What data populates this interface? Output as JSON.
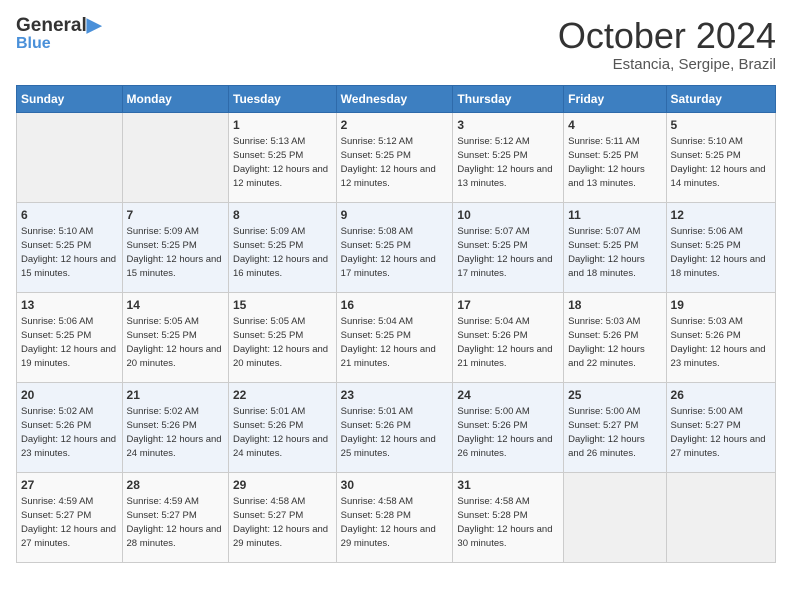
{
  "header": {
    "logo_line1": "General",
    "logo_line2": "Blue",
    "month": "October 2024",
    "location": "Estancia, Sergipe, Brazil"
  },
  "weekdays": [
    "Sunday",
    "Monday",
    "Tuesday",
    "Wednesday",
    "Thursday",
    "Friday",
    "Saturday"
  ],
  "weeks": [
    [
      {
        "day": "",
        "sunrise": "",
        "sunset": "",
        "daylight": ""
      },
      {
        "day": "",
        "sunrise": "",
        "sunset": "",
        "daylight": ""
      },
      {
        "day": "1",
        "sunrise": "5:13 AM",
        "sunset": "5:25 PM",
        "daylight": "12 hours and 12 minutes."
      },
      {
        "day": "2",
        "sunrise": "5:12 AM",
        "sunset": "5:25 PM",
        "daylight": "12 hours and 12 minutes."
      },
      {
        "day": "3",
        "sunrise": "5:12 AM",
        "sunset": "5:25 PM",
        "daylight": "12 hours and 13 minutes."
      },
      {
        "day": "4",
        "sunrise": "5:11 AM",
        "sunset": "5:25 PM",
        "daylight": "12 hours and 13 minutes."
      },
      {
        "day": "5",
        "sunrise": "5:10 AM",
        "sunset": "5:25 PM",
        "daylight": "12 hours and 14 minutes."
      }
    ],
    [
      {
        "day": "6",
        "sunrise": "5:10 AM",
        "sunset": "5:25 PM",
        "daylight": "12 hours and 15 minutes."
      },
      {
        "day": "7",
        "sunrise": "5:09 AM",
        "sunset": "5:25 PM",
        "daylight": "12 hours and 15 minutes."
      },
      {
        "day": "8",
        "sunrise": "5:09 AM",
        "sunset": "5:25 PM",
        "daylight": "12 hours and 16 minutes."
      },
      {
        "day": "9",
        "sunrise": "5:08 AM",
        "sunset": "5:25 PM",
        "daylight": "12 hours and 17 minutes."
      },
      {
        "day": "10",
        "sunrise": "5:07 AM",
        "sunset": "5:25 PM",
        "daylight": "12 hours and 17 minutes."
      },
      {
        "day": "11",
        "sunrise": "5:07 AM",
        "sunset": "5:25 PM",
        "daylight": "12 hours and 18 minutes."
      },
      {
        "day": "12",
        "sunrise": "5:06 AM",
        "sunset": "5:25 PM",
        "daylight": "12 hours and 18 minutes."
      }
    ],
    [
      {
        "day": "13",
        "sunrise": "5:06 AM",
        "sunset": "5:25 PM",
        "daylight": "12 hours and 19 minutes."
      },
      {
        "day": "14",
        "sunrise": "5:05 AM",
        "sunset": "5:25 PM",
        "daylight": "12 hours and 20 minutes."
      },
      {
        "day": "15",
        "sunrise": "5:05 AM",
        "sunset": "5:25 PM",
        "daylight": "12 hours and 20 minutes."
      },
      {
        "day": "16",
        "sunrise": "5:04 AM",
        "sunset": "5:25 PM",
        "daylight": "12 hours and 21 minutes."
      },
      {
        "day": "17",
        "sunrise": "5:04 AM",
        "sunset": "5:26 PM",
        "daylight": "12 hours and 21 minutes."
      },
      {
        "day": "18",
        "sunrise": "5:03 AM",
        "sunset": "5:26 PM",
        "daylight": "12 hours and 22 minutes."
      },
      {
        "day": "19",
        "sunrise": "5:03 AM",
        "sunset": "5:26 PM",
        "daylight": "12 hours and 23 minutes."
      }
    ],
    [
      {
        "day": "20",
        "sunrise": "5:02 AM",
        "sunset": "5:26 PM",
        "daylight": "12 hours and 23 minutes."
      },
      {
        "day": "21",
        "sunrise": "5:02 AM",
        "sunset": "5:26 PM",
        "daylight": "12 hours and 24 minutes."
      },
      {
        "day": "22",
        "sunrise": "5:01 AM",
        "sunset": "5:26 PM",
        "daylight": "12 hours and 24 minutes."
      },
      {
        "day": "23",
        "sunrise": "5:01 AM",
        "sunset": "5:26 PM",
        "daylight": "12 hours and 25 minutes."
      },
      {
        "day": "24",
        "sunrise": "5:00 AM",
        "sunset": "5:26 PM",
        "daylight": "12 hours and 26 minutes."
      },
      {
        "day": "25",
        "sunrise": "5:00 AM",
        "sunset": "5:27 PM",
        "daylight": "12 hours and 26 minutes."
      },
      {
        "day": "26",
        "sunrise": "5:00 AM",
        "sunset": "5:27 PM",
        "daylight": "12 hours and 27 minutes."
      }
    ],
    [
      {
        "day": "27",
        "sunrise": "4:59 AM",
        "sunset": "5:27 PM",
        "daylight": "12 hours and 27 minutes."
      },
      {
        "day": "28",
        "sunrise": "4:59 AM",
        "sunset": "5:27 PM",
        "daylight": "12 hours and 28 minutes."
      },
      {
        "day": "29",
        "sunrise": "4:58 AM",
        "sunset": "5:27 PM",
        "daylight": "12 hours and 29 minutes."
      },
      {
        "day": "30",
        "sunrise": "4:58 AM",
        "sunset": "5:28 PM",
        "daylight": "12 hours and 29 minutes."
      },
      {
        "day": "31",
        "sunrise": "4:58 AM",
        "sunset": "5:28 PM",
        "daylight": "12 hours and 30 minutes."
      },
      {
        "day": "",
        "sunrise": "",
        "sunset": "",
        "daylight": ""
      },
      {
        "day": "",
        "sunrise": "",
        "sunset": "",
        "daylight": ""
      }
    ]
  ],
  "labels": {
    "sunrise_prefix": "Sunrise: ",
    "sunset_prefix": "Sunset: ",
    "daylight_prefix": "Daylight: "
  }
}
